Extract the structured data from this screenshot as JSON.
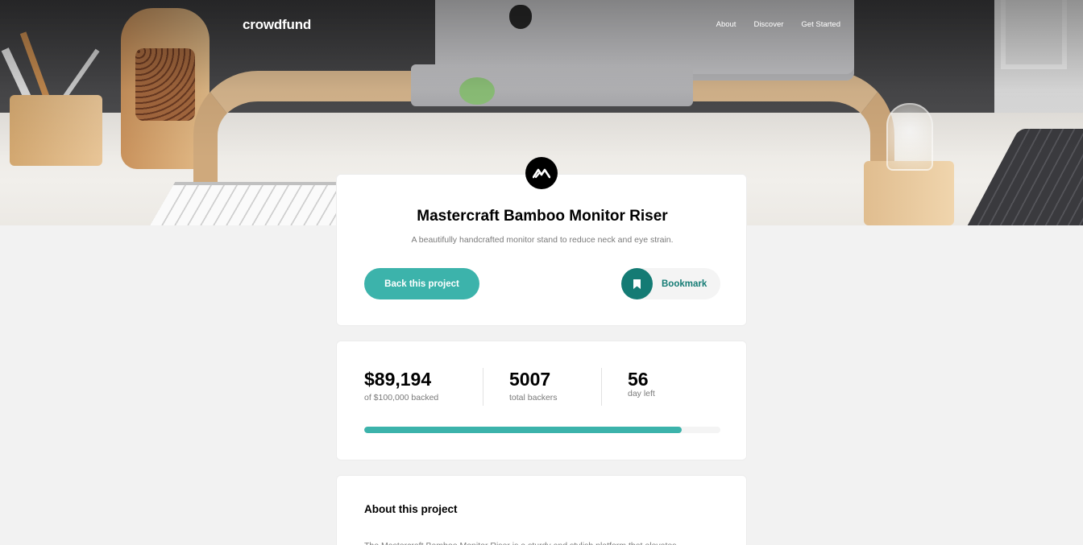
{
  "nav": {
    "logo": "crowdfund",
    "links": [
      "About",
      "Discover",
      "Get Started"
    ]
  },
  "project": {
    "title": "Mastercraft Bamboo Monitor Riser",
    "description": "A beautifully handcrafted monitor stand to reduce neck and eye strain.",
    "back_label": "Back this project",
    "bookmark_label": "Bookmark"
  },
  "stats": {
    "backed_amount": "$89,194",
    "backed_label": "of $100,000 backed",
    "backers": "5007",
    "backers_label": "total backers",
    "days": "56",
    "days_label": "day left",
    "progress_fraction": 0.89194
  },
  "about": {
    "title": "About this project",
    "text": "The Mastercraft Bamboo Monitor Riser is a sturdy and stylish platform that elevates"
  },
  "colors": {
    "accent": "#3cb3ab",
    "accent_dark": "#147b74",
    "background": "#f2f2f2"
  },
  "icons": {
    "brand": "mastercraft-logo-icon",
    "bookmark": "bookmark-icon"
  }
}
